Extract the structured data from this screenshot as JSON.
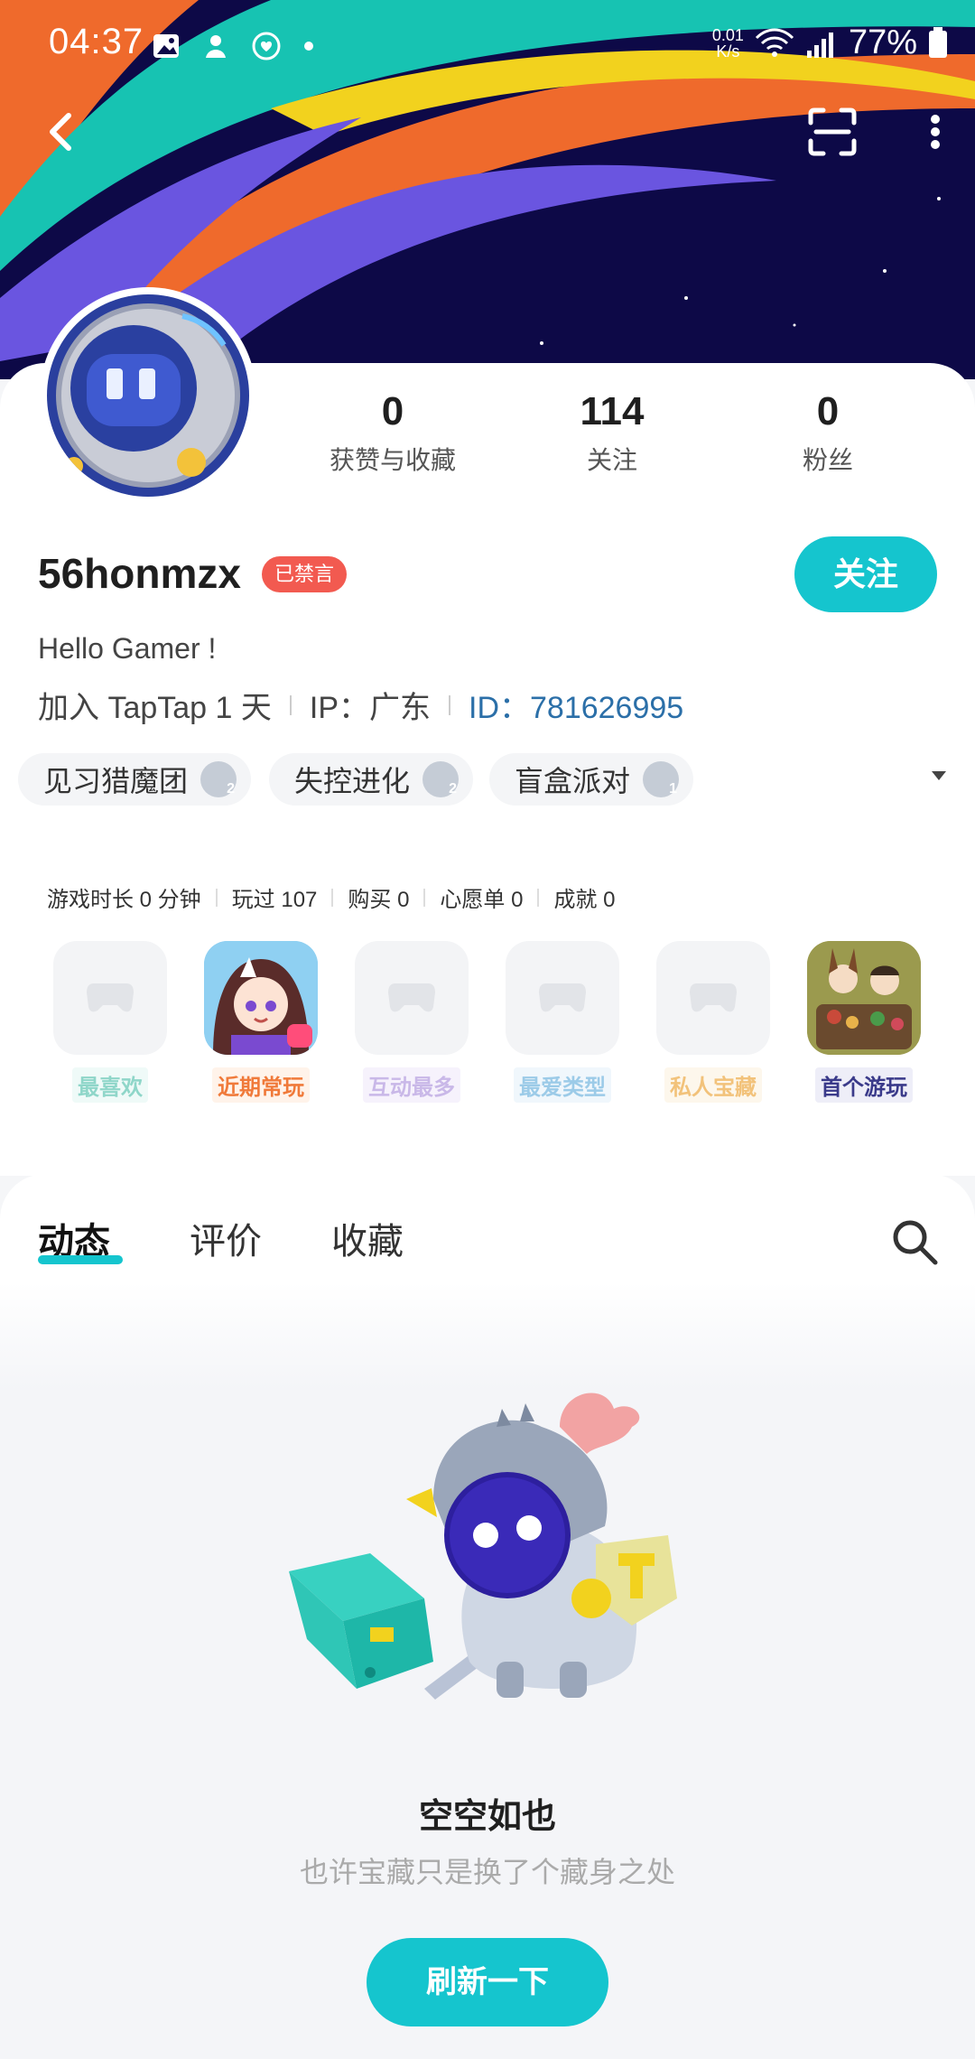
{
  "status_bar": {
    "time": "04:37",
    "net_speed_value": "0.01",
    "net_speed_unit": "K/s",
    "battery": "77%"
  },
  "profile": {
    "username": "56honmzx",
    "banned_badge": "已禁言",
    "follow_label": "关注",
    "bio": "Hello Gamer !",
    "joined": "加入 TapTap 1 天",
    "ip": "IP：广东",
    "id": "ID：781626995",
    "stats": [
      {
        "value": "0",
        "label": "获赞与收藏"
      },
      {
        "value": "114",
        "label": "关注"
      },
      {
        "value": "0",
        "label": "粉丝"
      }
    ]
  },
  "tags": [
    {
      "label": "见习猎魔团",
      "level": "2"
    },
    {
      "label": "失控进化",
      "level": "2"
    },
    {
      "label": "盲盒派对",
      "level": "1"
    }
  ],
  "games": {
    "stats": [
      "游戏时长 0 分钟",
      "玩过 107",
      "购买 0",
      "心愿单 0",
      "成就 0"
    ],
    "items": [
      {
        "label": "最喜欢",
        "color": "#8fd6c9"
      },
      {
        "label": "近期常玩",
        "color": "#f07a3a"
      },
      {
        "label": "互动最多",
        "color": "#c9b8e8"
      },
      {
        "label": "最爱类型",
        "color": "#9ccbe8"
      },
      {
        "label": "私人宝藏",
        "color": "#f2c27a"
      },
      {
        "label": "首个游玩",
        "color": "#3a3a8a"
      }
    ]
  },
  "tabs": [
    "动态",
    "评价",
    "收藏"
  ],
  "empty_state": {
    "title": "空空如也",
    "subtitle": "也许宝藏只是换了个藏身之处",
    "button": "刷新一下"
  }
}
